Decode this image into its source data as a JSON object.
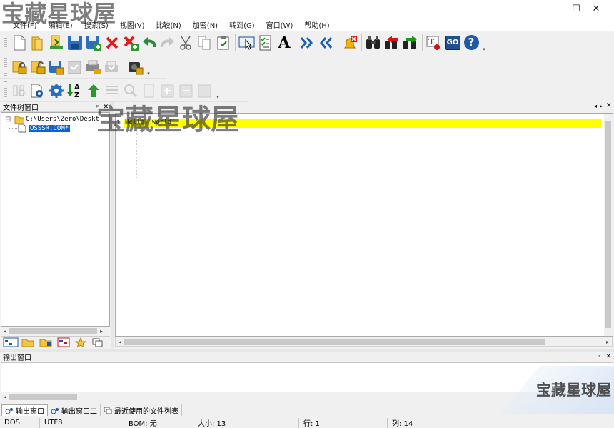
{
  "watermark": {
    "brand": "宝藏星球屋",
    "brand_center": "宝藏星球屋",
    "brand_corner": "宝藏星球屋"
  },
  "window": {
    "minimize_glyph": "—",
    "maximize_glyph": "☐",
    "close_glyph": "✕"
  },
  "menu": {
    "items": [
      "文件(F)",
      "编辑(E)",
      "搜索(S)",
      "视图(V)",
      "比较(N)",
      "加密(N)",
      "转到(G)",
      "窗口(W)",
      "帮助(H)"
    ]
  },
  "toolbar": {
    "row1_icons": [
      "new-file-icon",
      "open-folder-icon",
      "open-remote-icon",
      "save-icon",
      "save-all-icon",
      "close-file-icon",
      "close-all-icon",
      "undo-icon",
      "redo-icon",
      "cut-icon",
      "copy-icon",
      "paste-icon",
      "select-mode-icon",
      "checklist-icon",
      "font-icon",
      "indent-icon",
      "outdent-icon",
      "bell-alarm-icon",
      "find-icon",
      "find-previous-icon",
      "find-next-icon",
      "tools-icon",
      "go-icon",
      "help-icon"
    ],
    "font_glyph": "A",
    "go_label": "GO",
    "help_glyph": "?"
  },
  "tree_pane": {
    "title": "文件树窗口",
    "pin_glyph": "ᵖ",
    "close_glyph": "✕",
    "root_path": "C:\\Users\\Zero\\Deskt",
    "selected_file": "OSSSR.COM*",
    "expand_glyph": "⊟"
  },
  "editor": {
    "line1_number": "1",
    "line1_text": "Hello, world!",
    "tab_scroll_left": "◂",
    "tab_scroll_right": "▸",
    "tab_close": "✕",
    "highlight_color": "#ffff00"
  },
  "output_pane": {
    "title": "输出窗口",
    "pin_glyph": "ᵖ",
    "close_glyph": "✕",
    "tabs": [
      "输出窗口",
      "输出窗口二",
      "最近使用的文件列表"
    ]
  },
  "statusbar": {
    "line_ending": "DOS",
    "encoding": "UTF8",
    "bom": "BOM: 无",
    "size": "大小: 13",
    "row": "行: 1",
    "col": "列: 14"
  }
}
